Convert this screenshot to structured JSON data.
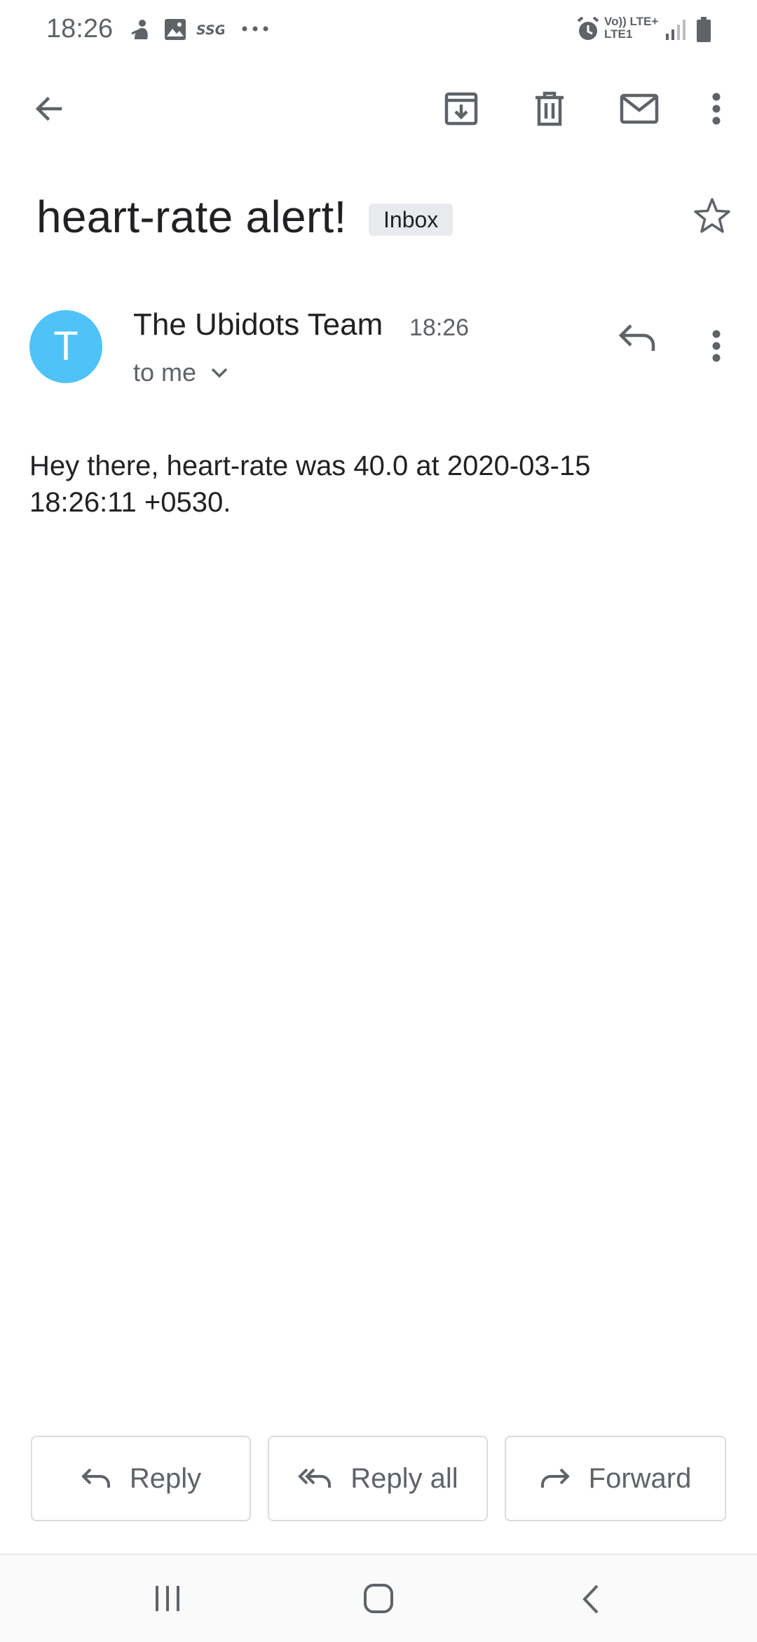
{
  "status_bar": {
    "time": "18:26",
    "network_label": "Vo)) LTE+\nLTE1",
    "icons": [
      "notification-icon",
      "gallery-icon",
      "ssg-icon",
      "more-dots-icon",
      "alarm-icon",
      "signal-icon",
      "battery-icon"
    ]
  },
  "toolbar": {
    "icons": [
      "back-arrow-icon",
      "archive-icon",
      "delete-icon",
      "mark-unread-icon",
      "more-vert-icon"
    ]
  },
  "email": {
    "subject": "heart-rate alert!",
    "label_chip": "Inbox",
    "sender": {
      "avatar_letter": "T",
      "avatar_color": "#4fc3f7",
      "name": "The Ubidots Team",
      "time": "18:26",
      "recipient": "to me"
    },
    "body_line1": "Hey there, heart-rate was 40.0 at 2020-03-15",
    "body_line2": "18:26:11 +0530."
  },
  "actions": {
    "reply_label": "Reply",
    "reply_all_label": "Reply all",
    "forward_label": "Forward"
  },
  "colors": {
    "icon_gray": "#5f6368",
    "text_dark": "#202124",
    "chip_bg": "#e8eaed",
    "border": "#dadce0"
  }
}
